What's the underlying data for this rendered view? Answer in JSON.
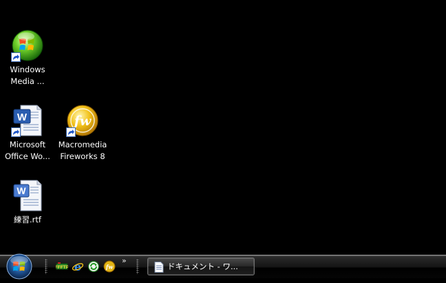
{
  "desktop": {
    "icons": [
      {
        "id": "wmp",
        "label": "Windows\nMedia ...",
        "icon": "windows-media-player-icon"
      },
      {
        "id": "word",
        "label": "Microsoft\nOffice Wo...",
        "icon": "word-icon"
      },
      {
        "id": "fireworks",
        "label": "Macromedia\nFireworks 8",
        "icon": "fireworks-icon"
      },
      {
        "id": "rtf",
        "label": "練習.rtf",
        "icon": "rtf-document-icon"
      }
    ]
  },
  "taskbar": {
    "quick_launch_more": "»",
    "quick_launch": [
      {
        "icon": "ftp-tool-icon"
      },
      {
        "icon": "internet-explorer-icon"
      },
      {
        "icon": "sync-green-icon"
      },
      {
        "icon": "fireworks-icon"
      }
    ],
    "tasks": [
      {
        "label": "ドキュメント - ワ...",
        "icon": "document-icon"
      }
    ]
  },
  "colors": {
    "desktop_background": "#000000",
    "icon_label_text": "#ffffff",
    "taskbar_background": "#0a0a0a"
  }
}
